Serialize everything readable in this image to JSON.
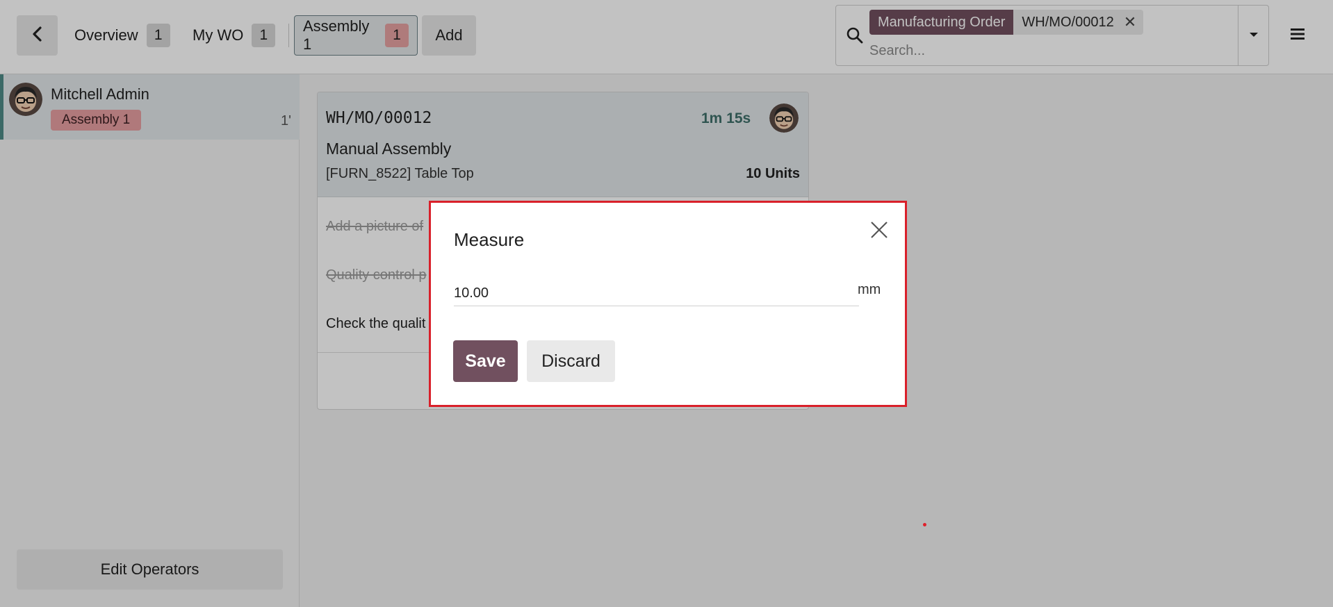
{
  "topbar": {
    "back_icon": "chevron-left-icon",
    "tabs": [
      {
        "label": "Overview",
        "count": "1"
      },
      {
        "label": "My WO",
        "count": "1"
      },
      {
        "label": "Assembly 1",
        "count": "1"
      }
    ],
    "add_label": "Add"
  },
  "search": {
    "facet_label": "Manufacturing Order",
    "facet_value": "WH/MO/00012",
    "placeholder": "Search...",
    "icon": "search-icon"
  },
  "operator": {
    "name": "Mitchell Admin",
    "badge": "Assembly 1",
    "time": "1'"
  },
  "left_panel": {
    "edit_operators_label": "Edit Operators"
  },
  "workorder": {
    "reference": "WH/MO/00012",
    "timer": "1m 15s",
    "operation": "Manual Assembly",
    "product": "[FURN_8522] Table Top",
    "quantity": "10 Units",
    "steps": [
      {
        "label": "Add a picture of",
        "done": true
      },
      {
        "label": "Quality control p",
        "done": true
      },
      {
        "label": "Check the qualit",
        "done": false
      }
    ]
  },
  "modal": {
    "title": "Measure",
    "value": "10.00",
    "unit": "mm",
    "save_label": "Save",
    "discard_label": "Discard"
  },
  "colors": {
    "brand": "#71505f",
    "accent_teal": "#4e8a86",
    "badge_pink": "#e8a0a2",
    "modal_highlight": "#d9202a"
  }
}
